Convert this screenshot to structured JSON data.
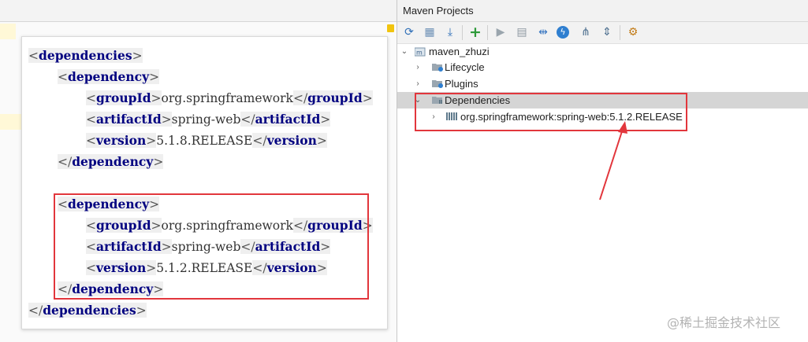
{
  "maven": {
    "title": "Maven Projects",
    "toolbar": [
      {
        "name": "reimport-icon",
        "glyph": "⟳",
        "color": "#2f6fb8"
      },
      {
        "name": "generate-sources-icon",
        "glyph": "▦",
        "color": "#6b8fb5"
      },
      {
        "name": "download-icon",
        "glyph": "⤓",
        "color": "#2f6fb8"
      },
      {
        "name": "add-icon",
        "glyph": "+",
        "color": "#2e9a3a"
      },
      {
        "name": "run-icon",
        "glyph": "▶",
        "color": "#9aa5ad"
      },
      {
        "name": "execute-goal-icon",
        "glyph": "▤",
        "color": "#8e99a2"
      },
      {
        "name": "toggle-offline-icon",
        "glyph": "⇹",
        "color": "#3b78c2"
      },
      {
        "name": "lightning-icon",
        "glyph": "ϟ",
        "color": "#ffffff"
      },
      {
        "name": "show-dependencies-icon",
        "glyph": "⋔",
        "color": "#4d6f8f"
      },
      {
        "name": "collapse-all-icon",
        "glyph": "⇕",
        "color": "#4d6f8f"
      },
      {
        "name": "settings-icon",
        "glyph": "⚙",
        "color": "#c27b16"
      }
    ],
    "tree": {
      "root": "maven_zhuzi",
      "lifecycle": "Lifecycle",
      "plugins": "Plugins",
      "dependencies": "Dependencies",
      "dependency_item": "org.springframework:spring-web:5.1.2.RELEASE"
    }
  },
  "code": {
    "dependencies_tag": "dependencies",
    "dependency_tag": "dependency",
    "groupId_tag": "groupId",
    "artifactId_tag": "artifactId",
    "version_tag": "version",
    "dep1": {
      "groupId": "org.springframework",
      "artifactId": "spring-web",
      "version": "5.1.8.RELEASE"
    },
    "dep2": {
      "groupId": "org.springframework",
      "artifactId": "spring-web",
      "version": "5.1.2.RELEASE"
    }
  },
  "watermark": "@稀土掘金技术社区",
  "colors": {
    "highlight_box": "#e2363c",
    "tag": "#000080",
    "selected_row": "#d5d5d5"
  }
}
